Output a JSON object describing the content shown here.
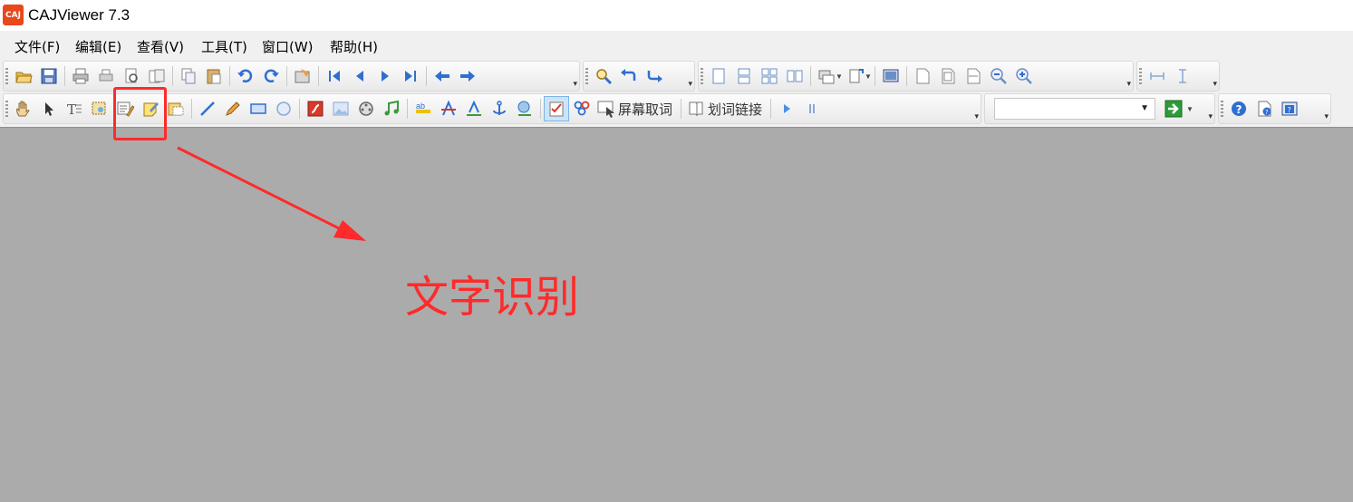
{
  "app": {
    "logo_text": "CAJ",
    "title": "CAJViewer 7.3"
  },
  "menu": [
    "文件(F)",
    "编辑(E)",
    "查看(V)",
    "工具(T)",
    "窗口(W)",
    "帮助(H)"
  ],
  "toolbar_row2": {
    "screen_word_label": "屏幕取词",
    "word_link_label": "划词链接",
    "search_value": ""
  },
  "annotation": {
    "label": "文字识别",
    "color": "#ff2a2a"
  },
  "colors": {
    "accent": "#e8481b",
    "workspace": "#ababab",
    "annotation": "#ff2a2a"
  }
}
